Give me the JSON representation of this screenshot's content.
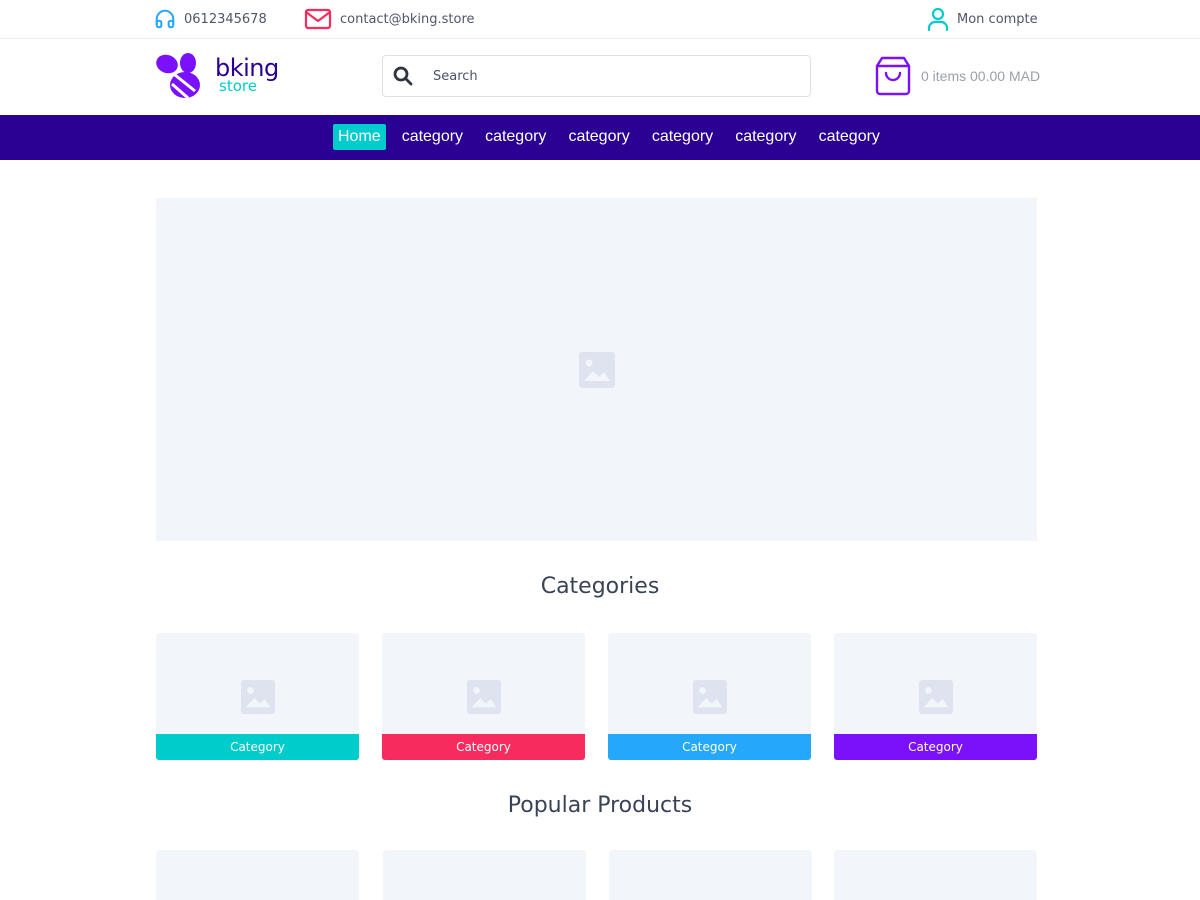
{
  "topbar": {
    "phone": "0612345678",
    "email": "contact@bking.store",
    "account": "Mon compte"
  },
  "header": {
    "logo_text": "bking",
    "logo_subtext": "store",
    "search_placeholder": "Search",
    "cart_text": "0 items 00.00 MAD"
  },
  "nav": {
    "items": [
      "Home",
      "category",
      "category",
      "category",
      "category",
      "category",
      "category"
    ]
  },
  "sections": {
    "categories_title": "Categories",
    "popular_title": "Popular Products"
  },
  "categories": [
    {
      "label": "Category",
      "color": "#00cccc"
    },
    {
      "label": "Category",
      "color": "#f72b5d"
    },
    {
      "label": "Category",
      "color": "#25a8fb"
    },
    {
      "label": "Category",
      "color": "#7b11fa"
    }
  ],
  "colors": {
    "brand": "#2a0193",
    "accent": "#00cccc",
    "placeholder_bg": "#f2f5f9",
    "placeholder_icon": "#dfe3f0"
  }
}
